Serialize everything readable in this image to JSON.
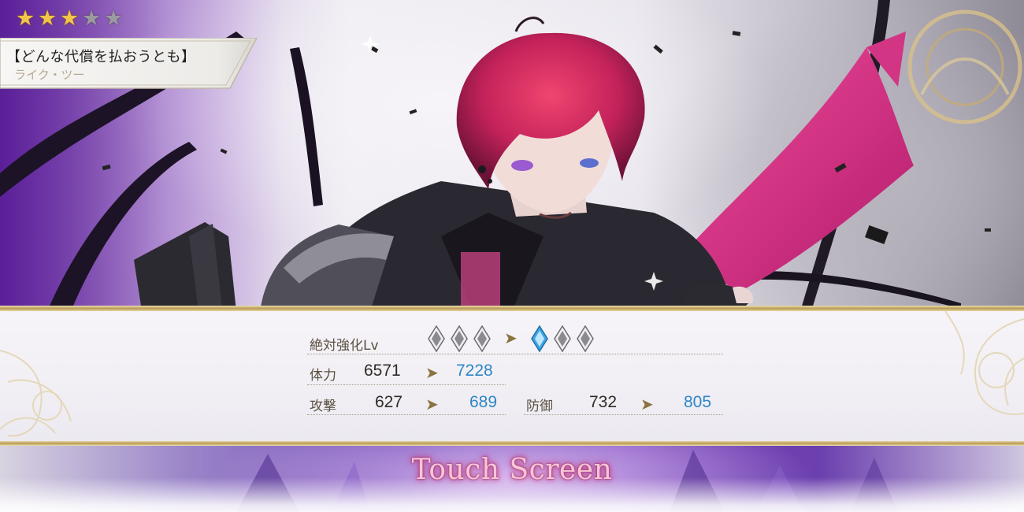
{
  "card": {
    "rarity_filled": 3,
    "rarity_max": 5,
    "title": "【どんな代償を払おうとも】",
    "character_name": "ライク・ツー"
  },
  "stats": {
    "absolute_enhance": {
      "label": "絶対強化Lv",
      "before_filled": 0,
      "after_filled": 1,
      "max": 3
    },
    "hp": {
      "label": "体力",
      "before": "6571",
      "after": "7228"
    },
    "attack": {
      "label": "攻撃",
      "before": "627",
      "after": "689"
    },
    "defense": {
      "label": "防御",
      "before": "732",
      "after": "805"
    }
  },
  "prompt": {
    "text": "Touch Screen"
  },
  "colors": {
    "new_value": "#2d86c6",
    "gold": "#b79a56",
    "star_on": "#f1c54a",
    "star_off": "#9b9aa0",
    "gem_active": "#3fa6e0",
    "gem_inactive": "#8a8a8f"
  },
  "icons": {
    "arrow": "chevron-right-icon",
    "gem": "diamond-gem-icon",
    "star": "star-icon"
  }
}
